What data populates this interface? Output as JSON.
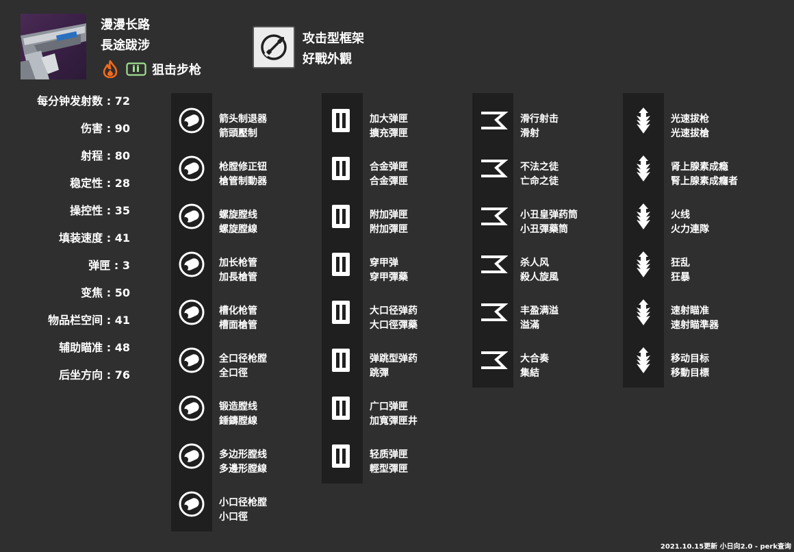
{
  "weapon": {
    "name_zh": "漫漫长路",
    "name_zht": "長途跋涉",
    "element_icon": "solar-flame-icon",
    "ammo_icon": "primary-ammo-icon",
    "type": "狙击步枪",
    "colors": {
      "solar": "#f26b1c",
      "primary_ammo": "#9fe08f",
      "frame_bg": "#ececec"
    }
  },
  "frame": {
    "icon": "aggressive-frame-icon",
    "name_zh": "攻击型框架",
    "name_zht": "好戰外觀"
  },
  "stats": [
    {
      "label": "每分钟发射数",
      "value": "72"
    },
    {
      "label": "伤害",
      "value": "90"
    },
    {
      "label": "射程",
      "value": "80"
    },
    {
      "label": "稳定性",
      "value": "28"
    },
    {
      "label": "操控性",
      "value": "35"
    },
    {
      "label": "填装速度",
      "value": "41"
    },
    {
      "label": "弹匣",
      "value": "3"
    },
    {
      "label": "变焦",
      "value": "50"
    },
    {
      "label": "物品栏空间",
      "value": "41"
    },
    {
      "label": "辅助瞄准",
      "value": "48"
    },
    {
      "label": "后坐方向",
      "value": "76"
    }
  ],
  "columns": [
    {
      "perks": [
        {
          "icon": "arrowhead-brake-icon",
          "zh": "箭头制退器",
          "zht": "箭頭壓制"
        },
        {
          "icon": "corkscrew-rifling-icon",
          "zh": "枪膛修正钮",
          "zht": "槍管制動器"
        },
        {
          "icon": "fluted-barrel-icon",
          "zh": "螺旋膛线",
          "zht": "螺旋膛線"
        },
        {
          "icon": "extended-barrel-icon",
          "zh": "加长枪管",
          "zht": "加長槍管"
        },
        {
          "icon": "fluted-barrel-icon",
          "zh": "槽化枪管",
          "zht": "槽面槍管"
        },
        {
          "icon": "full-bore-icon",
          "zh": "全口径枪膛",
          "zht": "全口徑"
        },
        {
          "icon": "hammer-forged-rifling-icon",
          "zh": "锻造膛线",
          "zht": "錘鑄膛線"
        },
        {
          "icon": "polygonal-rifling-icon",
          "zh": "多边形膛线",
          "zht": "多邊形膛線"
        },
        {
          "icon": "smallbore-icon",
          "zh": "小口径枪膛",
          "zht": "小口徑"
        }
      ]
    },
    {
      "perks": [
        {
          "icon": "extended-mag-icon",
          "zh": "加大弹匣",
          "zht": "擴充彈匣"
        },
        {
          "icon": "alloy-magazine-icon",
          "zh": "合金弹匣",
          "zht": "合金彈匣"
        },
        {
          "icon": "appended-mag-icon",
          "zh": "附加弹匣",
          "zht": "附加彈匣"
        },
        {
          "icon": "armor-piercing-rounds-icon",
          "zh": "穿甲弹",
          "zht": "穿甲彈藥"
        },
        {
          "icon": "high-caliber-rounds-icon",
          "zh": "大口径弹药",
          "zht": "大口徑彈藥"
        },
        {
          "icon": "ricochet-rounds-icon",
          "zh": "弹跳型弹药",
          "zht": "跳彈"
        },
        {
          "icon": "flared-magwell-icon",
          "zh": "广口弹匣",
          "zht": "加寬彈匣井"
        },
        {
          "icon": "light-mag-icon",
          "zh": "轻质弹匣",
          "zht": "輕型彈匣"
        }
      ]
    },
    {
      "perks": [
        {
          "icon": "slideshot-icon",
          "zh": "滑行射击",
          "zht": "滑射"
        },
        {
          "icon": "outlaw-icon",
          "zh": "不法之徒",
          "zht": "亡命之徒"
        },
        {
          "icon": "clown-cartridge-icon",
          "zh": "小丑皇弹药筒",
          "zht": "小丑彈藥筒"
        },
        {
          "icon": "killing-wind-icon",
          "zh": "杀人风",
          "zht": "殺人旋風"
        },
        {
          "icon": "overflow-icon",
          "zh": "丰盈满溢",
          "zht": "溢滿"
        },
        {
          "icon": "ensemble-icon",
          "zh": "大合奏",
          "zht": "集結"
        }
      ]
    },
    {
      "perks": [
        {
          "icon": "quickdraw-icon",
          "zh": "光速拔枪",
          "zht": "光速拔槍"
        },
        {
          "icon": "adrenaline-junkie-icon",
          "zh": "肾上腺素成瘾",
          "zht": "腎上腺素成癮者"
        },
        {
          "icon": "firing-line-icon",
          "zh": "火线",
          "zht": "火力連隊"
        },
        {
          "icon": "rampage-icon",
          "zh": "狂乱",
          "zht": "狂暴"
        },
        {
          "icon": "snapshot-sights-icon",
          "zh": "速射瞄准",
          "zht": "速射瞄準器"
        },
        {
          "icon": "moving-target-icon",
          "zh": "移动目标",
          "zht": "移動目標"
        }
      ]
    }
  ],
  "footer": "2021.10.15更新 小日向2.0 - perk查询"
}
